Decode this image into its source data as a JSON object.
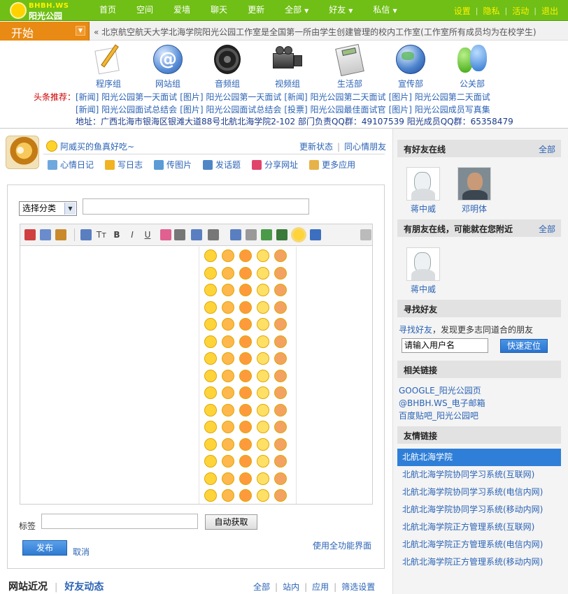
{
  "header": {
    "logo_line1": "BHBH.WS",
    "logo_line2": "阳光公园",
    "nav": [
      {
        "label": "首页",
        "caret": false
      },
      {
        "label": "空间",
        "caret": false
      },
      {
        "label": "爱墙",
        "caret": false
      },
      {
        "label": "聊天",
        "caret": false
      },
      {
        "label": "更新",
        "caret": false
      },
      {
        "label": "全部",
        "caret": true
      },
      {
        "label": "好友",
        "caret": true
      },
      {
        "label": "私信",
        "caret": true
      }
    ],
    "links": [
      "设置",
      "隐私",
      "活动",
      "退出"
    ],
    "separator": "|"
  },
  "ticker": {
    "start_label": "开始",
    "text": "« 北京航空航天大学北海学院阳光公园工作室是全国第一所由学生创建管理的校内工作室(工作室所有成员均为在校学生)"
  },
  "departments": [
    {
      "label": "程序组",
      "icon": "pencil-paper-icon"
    },
    {
      "label": "网站组",
      "icon": "at-sign-icon"
    },
    {
      "label": "音频组",
      "icon": "speaker-icon"
    },
    {
      "label": "视频组",
      "icon": "video-camera-icon"
    },
    {
      "label": "生活部",
      "icon": "calculator-icon"
    },
    {
      "label": "宣传部",
      "icon": "globe-icon"
    },
    {
      "label": "公关部",
      "icon": "messenger-people-icon"
    }
  ],
  "headline": {
    "label": "头条推荐：",
    "row1": [
      "[新闻] 阳光公园第一天面试",
      "[图片] 阳光公园第一天面试",
      "[新闻] 阳光公园第二天面试",
      "[图片] 阳光公园第二天面试"
    ],
    "row2": [
      "[新闻] 阳光公园面试总结会",
      "[图片] 阳光公园面试总结会",
      "[投票] 阳光公园最佳面试官",
      "[图片] 阳光公园成员写真集"
    ],
    "address": "地址：广西北海市银海区银滩大道88号北航北海学院2-102 部门负责QQ群：49107539 阳光成员QQ群：65358479"
  },
  "status": {
    "text": "阿威买的鱼真好吃~",
    "update_label": "更新状态",
    "mood_label": "同心情朋友"
  },
  "actions": [
    {
      "label": "心情日记",
      "icon": "speech-bubble-icon",
      "color": "#6fa8dc"
    },
    {
      "label": "写日志",
      "icon": "notepad-icon",
      "color": "#f0b323"
    },
    {
      "label": "传图片",
      "icon": "picture-icon",
      "color": "#5c9bd6"
    },
    {
      "label": "发话题",
      "icon": "people-topic-icon",
      "color": "#4f86c6"
    },
    {
      "label": "分享网址",
      "icon": "heart-share-icon",
      "color": "#e0446a"
    },
    {
      "label": "更多应用",
      "icon": "box-icon",
      "color": "#e6b34a"
    }
  ],
  "editor": {
    "category_label": "选择分类",
    "title_value": "",
    "toolbar": [
      "cut-icon",
      "copy-icon",
      "paste-icon",
      "font-icon",
      "font-size-icon",
      "bold-icon",
      "italic-icon",
      "underline-icon",
      "color-icon",
      "align-icon",
      "list-icon",
      "indent-icon",
      "link-icon",
      "unlink-icon",
      "image-icon",
      "video-icon",
      "emoticon-icon",
      "save-icon",
      "html-source-icon"
    ],
    "toolbar_text": {
      "tt": "Tт",
      "b": "B",
      "i": "I",
      "u": "U"
    },
    "tag_label": "标签",
    "tag_value": "",
    "auto_button": "自动获取",
    "publish_button": "发布",
    "cancel_link": "取消",
    "fullmode_link": "使用全功能界面",
    "emoji_colors": [
      "#ffd43b",
      "#ffb84d",
      "#ff9a3c",
      "#ffe066",
      "#f4a261"
    ]
  },
  "feed": {
    "tab_active": "网站近况",
    "tab_other": "好友动态",
    "filters": [
      "全部",
      "站内",
      "应用",
      "筛选设置"
    ]
  },
  "sidebar": {
    "online_friends": {
      "title": "有好友在线",
      "more": "全部",
      "friends": [
        {
          "name": "蒋中威",
          "photo": "sketch"
        },
        {
          "name": "邓明体",
          "photo": "photo"
        }
      ]
    },
    "nearby_friends": {
      "title": "有朋友在线，可能就在您附近",
      "more": "全部",
      "friends": [
        {
          "name": "蒋中威",
          "photo": "sketch"
        }
      ]
    },
    "find_friends": {
      "title": "寻找好友",
      "link": "寻找好友",
      "text": "，发现更多志同道合的朋友",
      "input_value": "请输入用户名",
      "button": "快速定位"
    },
    "related_links": {
      "title": "相关链接",
      "links": [
        "GOOGLE_阳光公园页",
        "@BHBH.WS_电子邮箱",
        "百度贴吧_阳光公园吧"
      ]
    },
    "friend_links": {
      "title": "友情链接",
      "links": [
        "北航北海学院",
        "北航北海学院协同学习系统(互联网)",
        "北航北海学院协同学习系统(电信内网)",
        "北航北海学院协同学习系统(移动内网)",
        "北航北海学院正方管理系统(互联网)",
        "北航北海学院正方管理系统(电信内网)",
        "北航北海学院正方管理系统(移动内网)"
      ]
    }
  }
}
